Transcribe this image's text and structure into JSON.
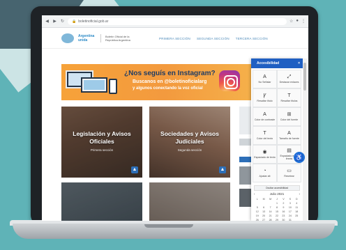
{
  "browser": {
    "url": "boletinoficial.gob.ar",
    "back_icon": "arrow-left-icon",
    "forward_icon": "arrow-right-icon",
    "reload_icon": "reload-icon"
  },
  "site": {
    "logo_brand": "Argentina unida",
    "logo_sub": "Boletín Oficial de la República Argentina",
    "nav": [
      "PRIMERA SECCIÓN",
      "SEGUNDA SECCIÓN",
      "TERCERA SECCIÓN"
    ]
  },
  "banner": {
    "title": "¿Nos seguís en Instagram?",
    "line1": "Buscanos en @boletinoficialarg",
    "line2": "y algunos conectando la voz oficial",
    "icon": "instagram-icon"
  },
  "cards": [
    {
      "title": "Legislación y Avisos Oficiales",
      "sub": "Primera sección"
    },
    {
      "title": "Sociedades y Avisos Judiciales",
      "sub": "Segunda sección"
    },
    {
      "title": "",
      "sub": ""
    },
    {
      "title": "",
      "sub": ""
    }
  ],
  "accessibility": {
    "header": "Accesibilidad",
    "close": "×",
    "tiles": [
      {
        "icon": "A",
        "label": "No Señalar"
      },
      {
        "icon": "⤢",
        "label": "Destacar enlaces"
      },
      {
        "icon": "Ꝩ",
        "label": "Resaltar título"
      },
      {
        "icon": "T",
        "label": "Resaltar títulos"
      },
      {
        "icon": "A",
        "label": "Color de contraste"
      },
      {
        "icon": "⊞",
        "label": "Color del fuente"
      },
      {
        "icon": "T",
        "label": "Color del texto"
      },
      {
        "icon": "A",
        "label": "Tamaño de fuente"
      },
      {
        "icon": "◉",
        "label": "Espaciado de texto"
      },
      {
        "icon": "▤",
        "label": "Espaciado entre líneas"
      },
      {
        "icon": "◔",
        "label": "Ajustar alt"
      },
      {
        "icon": "▭",
        "label": "Resetear"
      }
    ],
    "footer_button": "Ocultar accesibilidad",
    "calendar_month": "Julio 2021",
    "calendar_days": [
      "L",
      "M",
      "M",
      "J",
      "V",
      "S",
      "D"
    ],
    "calendar_rows": [
      [
        "",
        "",
        "",
        "1",
        "2",
        "3",
        "4"
      ],
      [
        "5",
        "6",
        "7",
        "8",
        "9",
        "10",
        "11"
      ],
      [
        "12",
        "13",
        "14",
        "15",
        "16",
        "17",
        "18"
      ],
      [
        "19",
        "20",
        "21",
        "22",
        "23",
        "24",
        "25"
      ],
      [
        "26",
        "27",
        "28",
        "29",
        "30",
        "31",
        ""
      ]
    ],
    "float_icon": "accessibility-person-icon",
    "float_glyph": "♿"
  }
}
